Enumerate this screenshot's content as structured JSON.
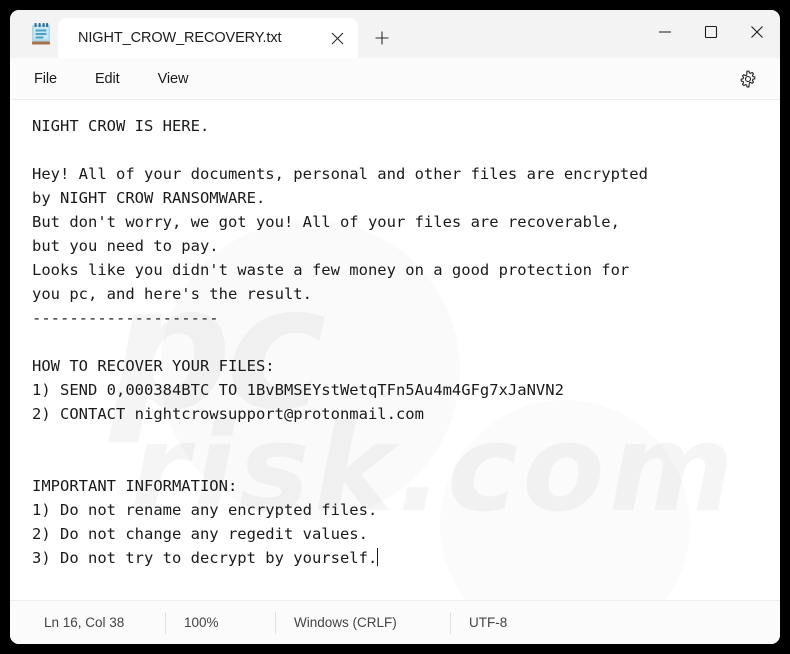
{
  "window": {
    "app_icon": "notepad-icon",
    "minimize_label": "—",
    "maximize_label": "□",
    "close_label": "✕"
  },
  "tab": {
    "title": "NIGHT_CROW_RECOVERY.txt",
    "close_label": "✕",
    "new_tab_label": "+"
  },
  "menu": {
    "items": [
      {
        "label": "File"
      },
      {
        "label": "Edit"
      },
      {
        "label": "View"
      }
    ],
    "settings_icon": "gear-icon"
  },
  "document": {
    "body": "NIGHT CROW IS HERE.\n\nHey! All of your documents, personal and other files are encrypted\nby NIGHT CROW RANSOMWARE.\nBut don't worry, we got you! All of your files are recoverable,\nbut you need to pay.\nLooks like you didn't waste a few money on a good protection for\nyou pc, and here's the result.\n--------------------\n\nHOW TO RECOVER YOUR FILES:\n1) SEND 0,000384BTC TO 1BvBMSEYstWetqTFn5Au4m4GFg7xJaNVN2\n2) CONTACT nightcrowsupport@protonmail.com\n\n\nIMPORTANT INFORMATION:\n1) Do not rename any encrypted files.\n2) Do not change any regedit values.\n3) Do not try to decrypt by yourself.",
    "watermark_main": "pc",
    "watermark_sub": "risk.com"
  },
  "statusbar": {
    "position": "Ln 16, Col 38",
    "zoom": "100%",
    "line_ending": "Windows (CRLF)",
    "encoding": "UTF-8"
  },
  "colors": {
    "titlebar_bg": "#f3f3f3",
    "tab_bg": "#ffffff",
    "editor_bg": "#ffffff",
    "text": "#1a1a1a",
    "status_text": "#444444",
    "icon_blue": "#7fc3e0",
    "icon_base": "#a9714b"
  }
}
